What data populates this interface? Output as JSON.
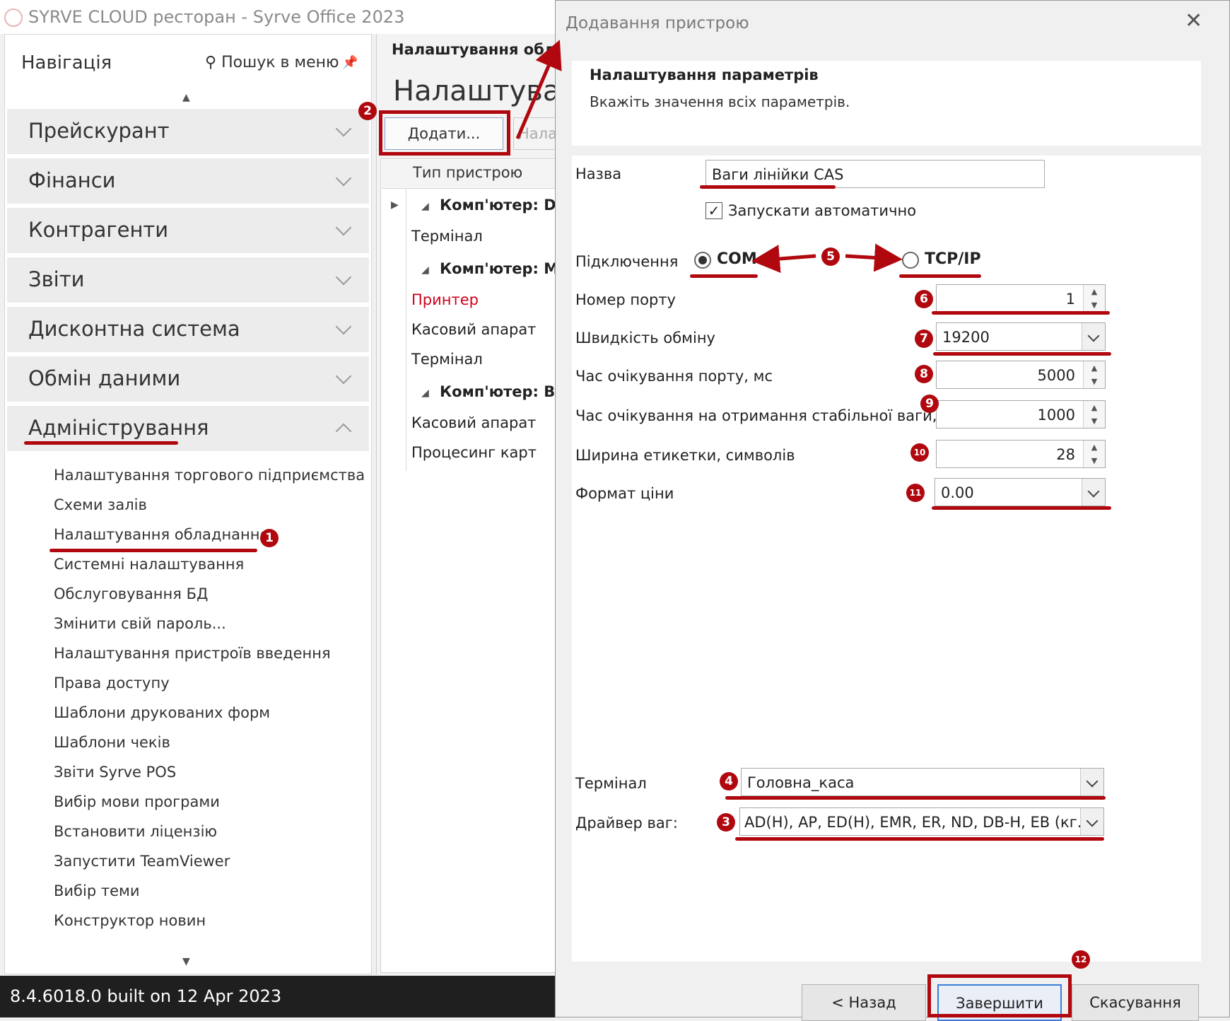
{
  "window": {
    "title": "SYRVE CLOUD ресторан - Syrve Office 2023"
  },
  "nav": {
    "title": "Навігація",
    "search_label": "Пошук в меню",
    "categories": [
      {
        "label": "Прейскурант"
      },
      {
        "label": "Фінанси"
      },
      {
        "label": "Контрагенти"
      },
      {
        "label": "Звіти"
      },
      {
        "label": "Дисконтна система"
      },
      {
        "label": "Обмін даними"
      },
      {
        "label": "Адміністрування",
        "expanded": true
      }
    ],
    "items": [
      {
        "label": "Налаштування торгового підприємства"
      },
      {
        "label": "Схеми залів"
      },
      {
        "label": "Налаштування обладнання"
      },
      {
        "label": "Системні налаштування"
      },
      {
        "label": "Обслуговування БД"
      },
      {
        "label": "Змінити свій пароль..."
      },
      {
        "label": "Налаштування пристроїв введення"
      },
      {
        "label": "Права доступу"
      },
      {
        "label": "Шаблони друкованих форм"
      },
      {
        "label": "Шаблони чеків"
      },
      {
        "label": "Звіти Syrve POS"
      },
      {
        "label": "Вибір мови програми"
      },
      {
        "label": "Встановити ліцензію"
      },
      {
        "label": "Запустити TeamViewer"
      },
      {
        "label": "Вибір теми"
      },
      {
        "label": "Конструктор новин"
      }
    ]
  },
  "status": {
    "version": "8.4.6018.0 built on 12 Apr 2023"
  },
  "content": {
    "tab": "Налаштування обла",
    "title": "Налаштуван",
    "add_button": "Додати...",
    "second_button": "Нала",
    "grid_header": "Тип пристрою",
    "rows": [
      {
        "label": "Комп'ютер: DI",
        "group": true
      },
      {
        "label": "Термінал"
      },
      {
        "label": "Комп'ютер: M.",
        "group": true
      },
      {
        "label": "Принтер",
        "highlight": true
      },
      {
        "label": "Касовий апарат"
      },
      {
        "label": "Термінал"
      },
      {
        "label": "Комп'ютер: Ві",
        "group": true
      },
      {
        "label": "Касовий апарат"
      },
      {
        "label": "Процесинг карт"
      }
    ]
  },
  "dialog": {
    "title": "Додавання пристрою",
    "heading": "Налаштування параметрів",
    "subheading": "Вкажіть значення всіх параметрів.",
    "name_label": "Назва",
    "name_value": "Ваги лінійки CAS",
    "autostart_label": "Запускати автоматично",
    "autostart_checked": true,
    "connection_label": "Підключення",
    "connection_options": [
      "COM",
      "TCP/IP"
    ],
    "connection_selected": "COM",
    "fields": [
      {
        "label": "Номер порту",
        "value": "1",
        "kind": "spin"
      },
      {
        "label": "Швидкість обміну",
        "value": "19200",
        "kind": "dropdown"
      },
      {
        "label": "Час очікування порту, мс",
        "value": "5000",
        "kind": "spin"
      },
      {
        "label": "Час очікування на отримання стабільної ваги, мс",
        "value": "1000",
        "kind": "spin"
      },
      {
        "label": "Ширина етикетки, символів",
        "value": "28",
        "kind": "spin"
      },
      {
        "label": "Формат ціни",
        "value": "0.00",
        "kind": "dropdown"
      }
    ],
    "terminal_label": "Термінал",
    "terminal_value": "Головна_каса",
    "driver_label": "Драйвер ваг:",
    "driver_value": "AD(H), AP, ED(H), EMR, ER, ND, DB-H, EB (кг.)",
    "buttons": {
      "back": "< Назад",
      "finish": "Завершити",
      "cancel": "Скасування"
    }
  },
  "annotations": {
    "color": "#b0080e",
    "badges": [
      "1",
      "2",
      "3",
      "4",
      "5",
      "6",
      "7",
      "8",
      "9",
      "10",
      "11",
      "12"
    ]
  }
}
